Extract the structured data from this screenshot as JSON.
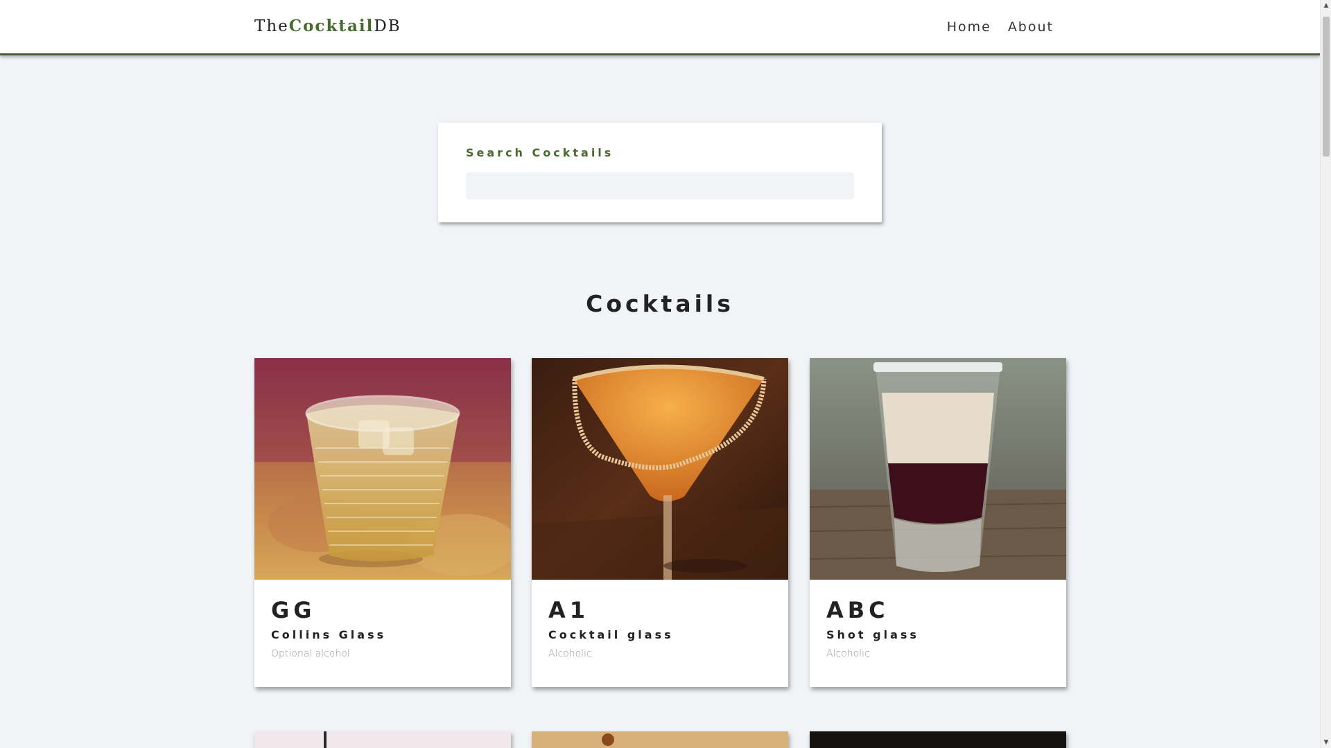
{
  "nav": {
    "logo_prefix": "The",
    "logo_mid": "Cocktail",
    "logo_suffix": "DB",
    "links": [
      {
        "label": "Home"
      },
      {
        "label": "About"
      }
    ]
  },
  "search": {
    "label": "Search Cocktails",
    "value": "",
    "placeholder": ""
  },
  "section": {
    "title": "Cocktails"
  },
  "cards": [
    {
      "name": "GG",
      "glass": "Collins Glass",
      "alcoholic": "Optional alcohol",
      "image": "glass-of-pale-yellow-drink-with-ice"
    },
    {
      "name": "A1",
      "glass": "Cocktail glass",
      "alcoholic": "Alcoholic",
      "image": "orange-martini-with-sugar-rim"
    },
    {
      "name": "ABC",
      "glass": "Shot glass",
      "alcoholic": "Alcoholic",
      "image": "layered-shot-cream-over-dark-red"
    },
    {
      "name": "",
      "glass": "",
      "alcoholic": "",
      "image": "partially-visible-light-photo"
    },
    {
      "name": "",
      "glass": "",
      "alcoholic": "",
      "image": "partially-visible-amber-photo"
    },
    {
      "name": "",
      "glass": "",
      "alcoholic": "",
      "image": "partially-visible-dark-photo"
    }
  ],
  "colors": {
    "accent": "#476b2f",
    "background": "#f0f4f6",
    "navbar_border": "#4a5a3a"
  }
}
